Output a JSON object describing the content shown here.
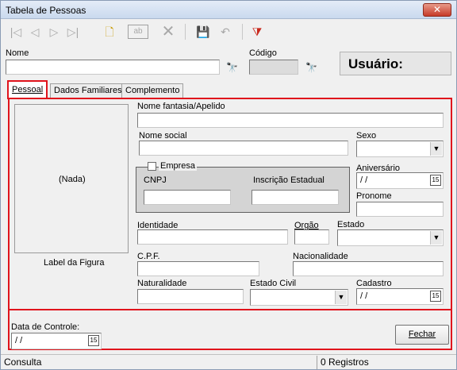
{
  "window": {
    "title": "Tabela de Pessoas",
    "close_label": "✕"
  },
  "toolbar": {
    "first": "|◁",
    "prev": "◁",
    "next": "▷",
    "last": "▷|",
    "new": "🗋",
    "edit": "ab",
    "delete": "✕",
    "save": "💾",
    "undo": "↶",
    "filter": "⧩"
  },
  "header": {
    "nome_label": "Nome",
    "nome_value": "",
    "codigo_label": "Código",
    "search_glyph": "🔭",
    "usuario_label": "Usuário:"
  },
  "tabs": [
    {
      "label": "Pessoal"
    },
    {
      "label": "Dados Familiares"
    },
    {
      "label": "Complemento"
    }
  ],
  "photo": {
    "placeholder": "(Nada)",
    "caption": "Label da Figura"
  },
  "form": {
    "nome_fantasia_label": "Nome fantasia/Apelido",
    "nome_social_label": "Nome social",
    "sexo_label": "Sexo",
    "empresa_label": "Empresa",
    "cnpj_label": "CNPJ",
    "inscricao_label": "Inscrição Estadual",
    "aniversario_label": "Aniversário",
    "aniversario_value": "/ /",
    "pronome_label": "Pronome",
    "identidade_label": "Identidade",
    "orgao_label": "Orgão",
    "estado_label": "Estado",
    "cpf_label": "C.P.F.",
    "nacionalidade_label": "Nacionalidade",
    "naturalidade_label": "Naturalidade",
    "estado_civil_label": "Estado Civil",
    "cadastro_label": "Cadastro",
    "cadastro_value": "/ /",
    "data_controle_label": "Data de Controle:",
    "data_controle_value": "/ /",
    "calendar_glyph": "15"
  },
  "buttons": {
    "fechar": "Fechar"
  },
  "status": {
    "mode": "Consulta",
    "records": "0 Registros"
  }
}
